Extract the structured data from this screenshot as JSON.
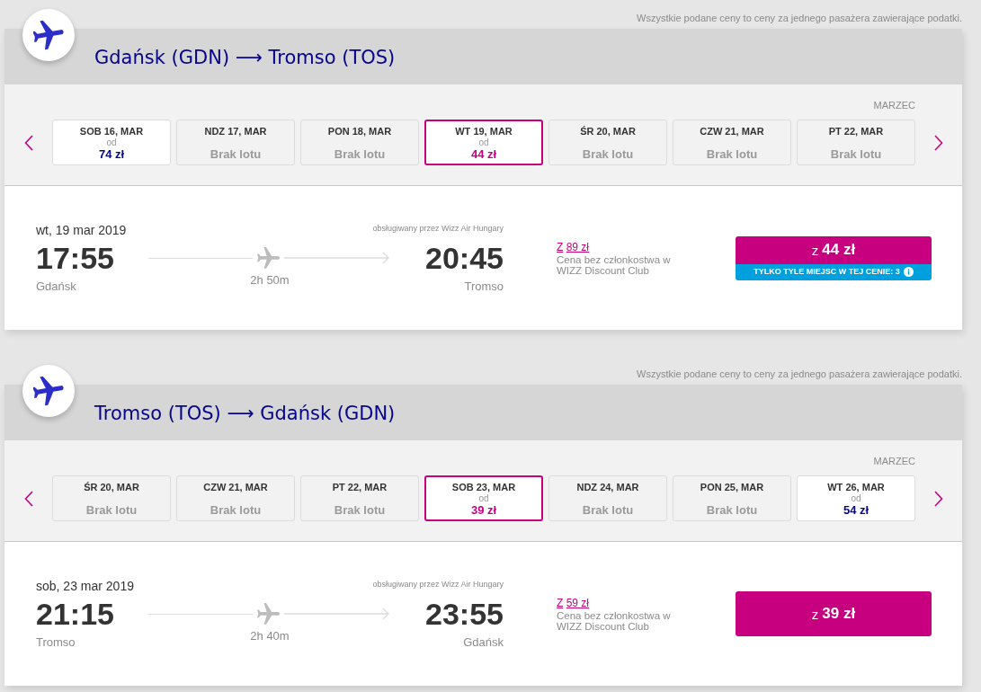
{
  "sections": [
    {
      "price_note": "Wszystkie podane ceny to ceny za jednego pasażera zawierające podatki.",
      "title": "Gdańsk (GDN) ⟶ Tromso (TOS)",
      "month": "MARZEC",
      "dates": [
        {
          "kind": "fare",
          "day": "SOB 16, MAR",
          "from": "od",
          "price": "74 zł",
          "selected": false
        },
        {
          "kind": "no_flight",
          "day": "NDZ 17, MAR",
          "note": "Brak lotu",
          "selected": false
        },
        {
          "kind": "no_flight",
          "day": "PON 18, MAR",
          "note": "Brak lotu",
          "selected": false
        },
        {
          "kind": "fare",
          "day": "WT 19, MAR",
          "from": "od",
          "price": "44 zł",
          "selected": true
        },
        {
          "kind": "no_flight",
          "day": "ŚR 20, MAR",
          "note": "Brak lotu",
          "selected": false
        },
        {
          "kind": "no_flight",
          "day": "CZW 21, MAR",
          "note": "Brak lotu",
          "selected": false
        },
        {
          "kind": "no_flight",
          "day": "PT 22, MAR",
          "note": "Brak lotu",
          "selected": false
        }
      ],
      "flight": {
        "date": "wt, 19 mar 2019",
        "operated_by": "obsługiwany przez Wizz Air Hungary",
        "departure": {
          "time": "17:55",
          "city": "Gdańsk"
        },
        "duration": "2h 50m",
        "arrival": {
          "time": "20:45",
          "city": "Tromso"
        },
        "regular_price": {
          "prefix": "Z",
          "amount": "89 zł"
        },
        "regular_price_note": "Cena bez członkostwa w WIZZ Discount Club",
        "fare_button": {
          "prefix": "z",
          "amount": "44 zł"
        },
        "seats_note": "TYLKO TYLE MIEJSC W TEJ CENIE: 3"
      }
    },
    {
      "price_note": "Wszystkie podane ceny to ceny za jednego pasażera zawierające podatki.",
      "title": "Tromso (TOS) ⟶ Gdańsk (GDN)",
      "month": "MARZEC",
      "dates": [
        {
          "kind": "no_flight",
          "day": "ŚR 20, MAR",
          "note": "Brak lotu",
          "selected": false
        },
        {
          "kind": "no_flight",
          "day": "CZW 21, MAR",
          "note": "Brak lotu",
          "selected": false
        },
        {
          "kind": "no_flight",
          "day": "PT 22, MAR",
          "note": "Brak lotu",
          "selected": false
        },
        {
          "kind": "fare",
          "day": "SOB 23, MAR",
          "from": "od",
          "price": "39 zł",
          "selected": true
        },
        {
          "kind": "no_flight",
          "day": "NDZ 24, MAR",
          "note": "Brak lotu",
          "selected": false
        },
        {
          "kind": "no_flight",
          "day": "PON 25, MAR",
          "note": "Brak lotu",
          "selected": false
        },
        {
          "kind": "fare",
          "day": "WT 26, MAR",
          "from": "od",
          "price": "54 zł",
          "selected": false
        }
      ],
      "flight": {
        "date": "sob, 23 mar 2019",
        "operated_by": "obsługiwany przez Wizz Air Hungary",
        "departure": {
          "time": "21:15",
          "city": "Tromso"
        },
        "duration": "2h 40m",
        "arrival": {
          "time": "23:55",
          "city": "Gdańsk"
        },
        "regular_price": {
          "prefix": "Z",
          "amount": "59 zł"
        },
        "regular_price_note": "Cena bez członkostwa w WIZZ Discount Club",
        "fare_button": {
          "prefix": "z",
          "amount": "39 zł"
        }
      }
    }
  ]
}
